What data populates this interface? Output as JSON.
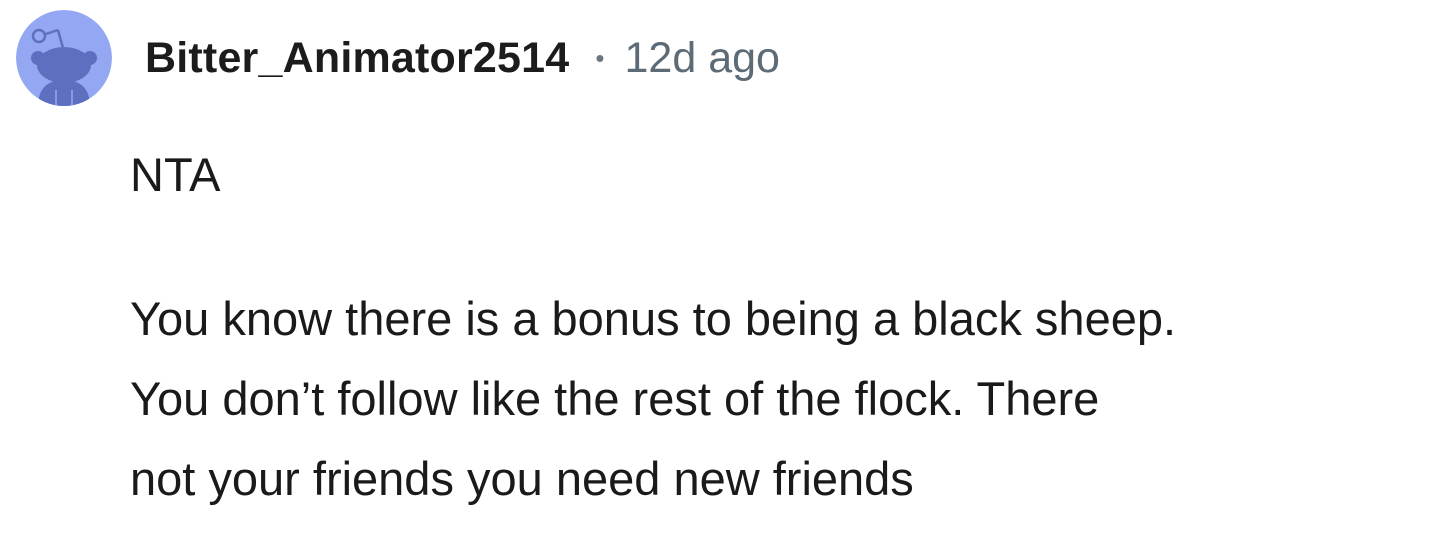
{
  "comment": {
    "author": "Bitter_Animator2514",
    "separator": "•",
    "timestamp": "12d ago",
    "avatar_icon": "snoo-avatar-icon",
    "avatar_bg": "#94a7f2",
    "avatar_fg": "#5f6fbf",
    "body": {
      "verdict": "NTA",
      "lines": [
        "You know there is a bonus to being a black sheep.",
        "You don’t follow like the rest of the flock. There",
        "not your friends you need new friends"
      ]
    }
  }
}
